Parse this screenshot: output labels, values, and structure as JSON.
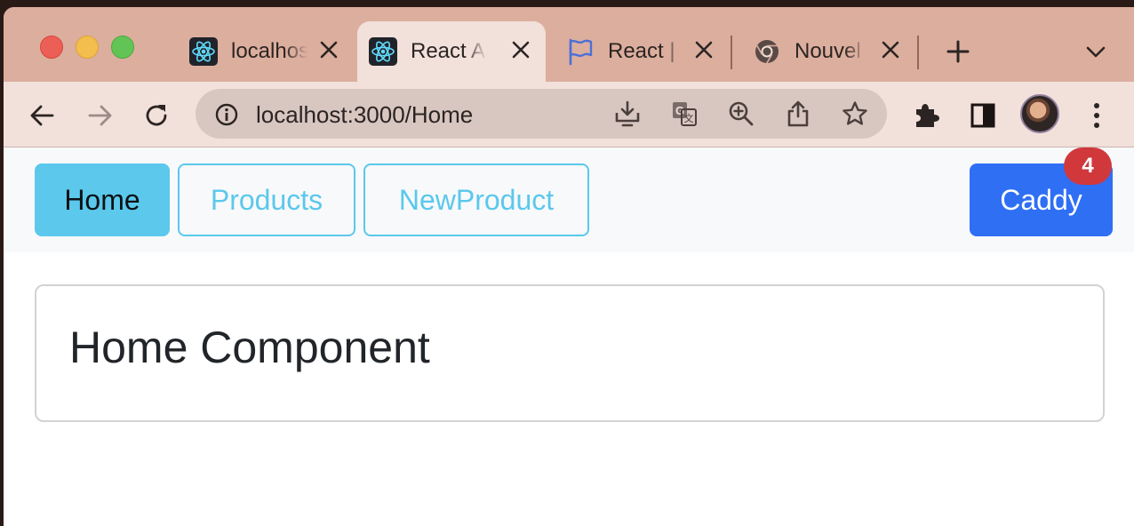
{
  "browser": {
    "tabs": [
      {
        "title": "localhost",
        "favicon": "react-icon",
        "active": false
      },
      {
        "title": "React App",
        "favicon": "react-icon",
        "active": true
      },
      {
        "title": "React |",
        "favicon": "flag-icon",
        "active": false
      },
      {
        "title": "Nouvel",
        "favicon": "chrome-icon",
        "active": false
      }
    ],
    "url": "localhost:3000/Home",
    "colors": {
      "tabstrip": "#dcae9e",
      "toolbar": "#f2e0da",
      "omnibox": "#d8c6c0"
    }
  },
  "page": {
    "nav": {
      "home_label": "Home",
      "products_label": "Products",
      "newproduct_label": "NewProduct",
      "caddy_label": "Caddy",
      "caddy_count": "4"
    },
    "card": {
      "title": "Home Component"
    },
    "colors": {
      "info": "#5bc8ec",
      "primary": "#2f6ff4",
      "badge": "#d0383c"
    }
  }
}
